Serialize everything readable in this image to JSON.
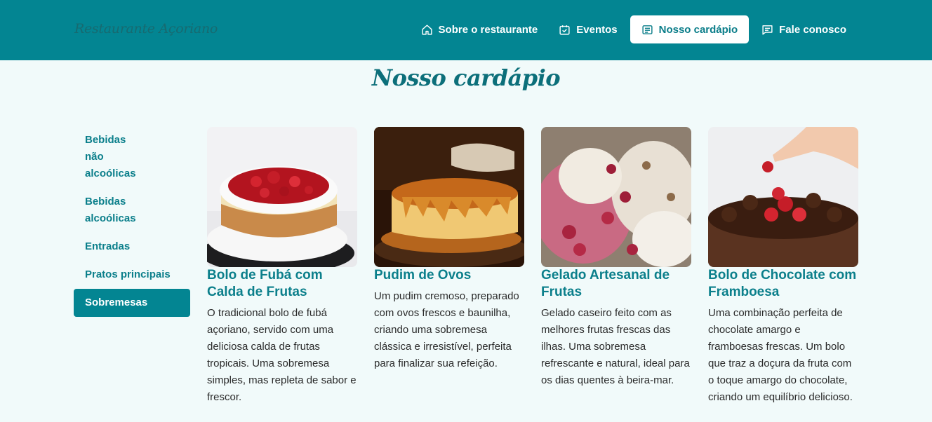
{
  "header": {
    "brand": "Restaurante Açoriano",
    "nav": [
      {
        "label": "Sobre o restaurante",
        "icon": "home-icon"
      },
      {
        "label": "Eventos",
        "icon": "calendar-check-icon"
      },
      {
        "label": "Nosso cardápio",
        "icon": "menu-list-icon",
        "active": true
      },
      {
        "label": "Fale conosco",
        "icon": "chat-icon"
      }
    ]
  },
  "page": {
    "title": "Nosso cardápio"
  },
  "sidebar": {
    "items": [
      {
        "label": "Bebidas não alcoólicas"
      },
      {
        "label": "Bebidas alcoólicas"
      },
      {
        "label": "Entradas"
      },
      {
        "label": "Pratos principais"
      },
      {
        "label": "Sobremesas",
        "active": true
      }
    ]
  },
  "cards": [
    {
      "title": "Bolo de Fubá com Calda de Frutas",
      "description": "O tradicional bolo de fubá açoriano, servido com uma deliciosa calda de frutas tropicais. Uma sobremesa simples, mas repleta de sabor e frescor."
    },
    {
      "title": "Pudim de Ovos",
      "description": "Um pudim cremoso, preparado com ovos frescos e baunilha, criando uma sobremesa clássica e irresistível, perfeita para finalizar sua refeição."
    },
    {
      "title": "Gelado Artesanal de Frutas",
      "description": "Gelado caseiro feito com as melhores frutas frescas das ilhas. Uma sobremesa refrescante e natural, ideal para os dias quentes à beira-mar."
    },
    {
      "title": "Bolo de Chocolate com Framboesa",
      "description": "Uma combinação perfeita de chocolate amargo e framboesas frescas. Um bolo que traz a doçura da fruta com o toque amargo do chocolate, criando um equilíbrio delicioso."
    }
  ],
  "colors": {
    "primary": "#038592",
    "background": "#f1fafa",
    "accent_text": "#0b7f8b"
  }
}
